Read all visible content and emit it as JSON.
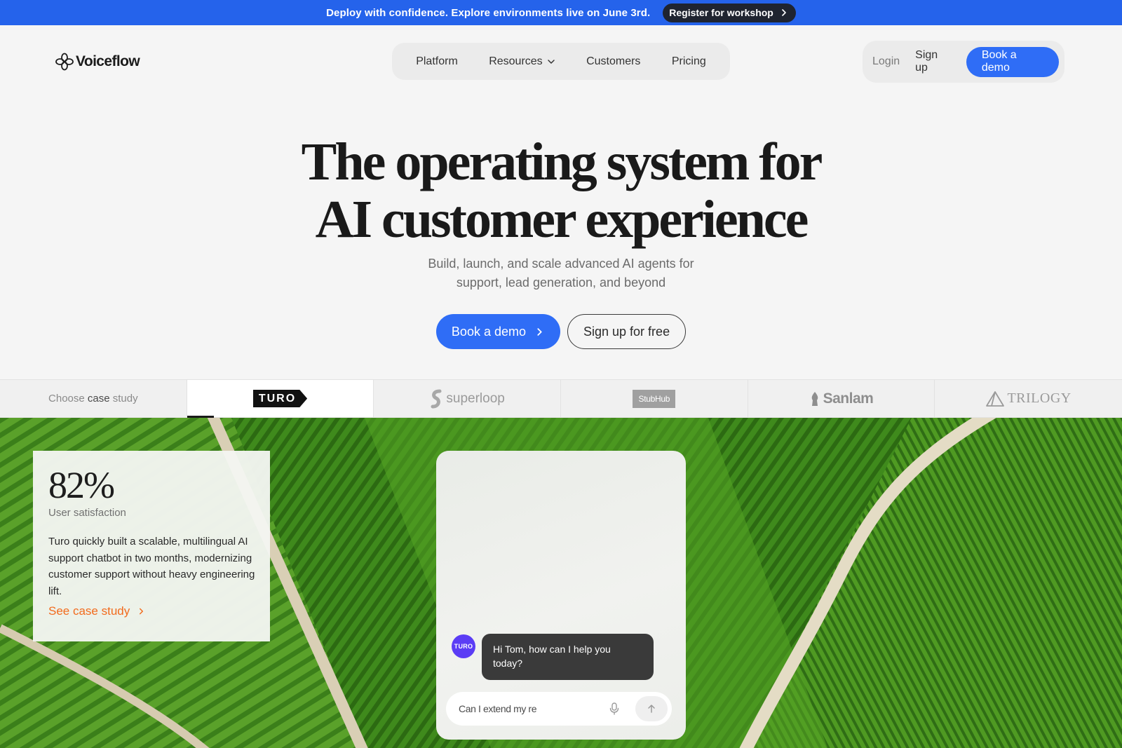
{
  "announcement": {
    "text": "Deploy with confidence. Explore environments live on June 3rd.",
    "button_label": "Register for workshop"
  },
  "brand": {
    "name": "Voiceflow"
  },
  "nav": {
    "items": [
      {
        "label": "Platform"
      },
      {
        "label": "Resources"
      },
      {
        "label": "Customers"
      },
      {
        "label": "Pricing"
      }
    ]
  },
  "auth": {
    "login_label": "Login",
    "signup_label": "Sign up",
    "demo_label": "Book a demo"
  },
  "hero": {
    "title_line1": "The operating system for",
    "title_line2": "AI customer experience",
    "subtitle_line1": "Build, launch, and scale advanced AI agents for",
    "subtitle_line2": "support, lead generation, and beyond",
    "cta_primary": "Book a demo",
    "cta_secondary": "Sign up for free"
  },
  "case_strip": {
    "label_part1": "Choose ",
    "label_part2": "case",
    "label_part3": " study",
    "logos": [
      {
        "name": "TURO",
        "active": true
      },
      {
        "name": "superloop",
        "active": false
      },
      {
        "name": "StubHub",
        "active": false
      },
      {
        "name": "Sanlam",
        "active": false
      },
      {
        "name": "TRILOGY",
        "active": false
      }
    ]
  },
  "case_study": {
    "stat_value": "82%",
    "stat_label": "User satisfaction",
    "body": "Turo quickly built a scalable, multilingual AI support chatbot in two months, modernizing customer support without heavy engineering lift.",
    "link_label": "See case study"
  },
  "chat": {
    "avatar_label": "TURO",
    "message": "Hi Tom, how can I help you today?",
    "input_value": "Can I extend my re"
  },
  "colors": {
    "accent_blue": "#2f6df6",
    "announcement_bg": "#2563eb",
    "link_orange": "#f26b1d",
    "chat_avatar": "#5b3df5"
  },
  "icons": {
    "logo": "flower-logo-icon",
    "chevron": "chevron-right-icon",
    "dropdown": "chevron-down-icon",
    "mic": "microphone-icon",
    "send": "arrow-up-icon"
  }
}
